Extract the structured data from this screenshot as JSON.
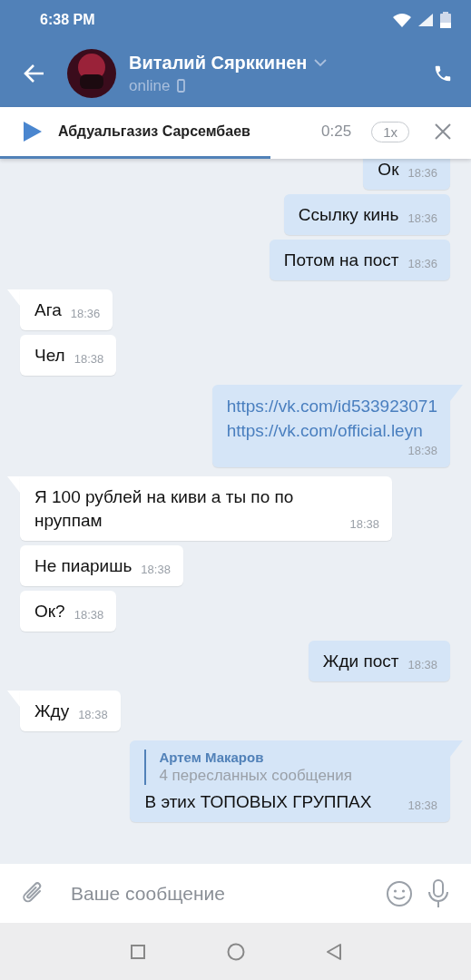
{
  "status_bar": {
    "time": "6:38 PM"
  },
  "header": {
    "name": "Виталий Сярккинен",
    "status": "online"
  },
  "audio_player": {
    "title": "Абдуальгазиз Сарсембаев",
    "duration": "0:25",
    "speed": "1x",
    "level": 0.575
  },
  "messages": [
    {
      "kind": "text",
      "outgoing": true,
      "tail": false,
      "text": "Ок",
      "time": "18:36"
    },
    {
      "kind": "text",
      "outgoing": true,
      "tail": false,
      "text": "Ссылку кинь",
      "time": "18:36"
    },
    {
      "kind": "text",
      "outgoing": true,
      "tail": false,
      "text": "Потом на пост",
      "time": "18:36"
    },
    {
      "kind": "text",
      "outgoing": false,
      "tail": true,
      "text": "Ага",
      "time": "18:36"
    },
    {
      "kind": "text",
      "outgoing": false,
      "tail": false,
      "text": "Чел",
      "time": "18:38"
    },
    {
      "kind": "links",
      "outgoing": true,
      "tail": true,
      "links": [
        "https://vk.com/id533923071",
        "https://vk.com/official.leyn"
      ],
      "time": "18:38"
    },
    {
      "kind": "text",
      "outgoing": false,
      "tail": true,
      "text": "Я 100 рублей на киви а ты по по нруппам",
      "time": "18:38"
    },
    {
      "kind": "text",
      "outgoing": false,
      "tail": false,
      "text": "Не пиаришь",
      "time": "18:38"
    },
    {
      "kind": "text",
      "outgoing": false,
      "tail": false,
      "text": "Ок?",
      "time": "18:38"
    },
    {
      "kind": "text",
      "outgoing": true,
      "tail": false,
      "text": "Жди пост",
      "time": "18:38"
    },
    {
      "kind": "text",
      "outgoing": false,
      "tail": true,
      "text": "Жду",
      "time": "18:38"
    },
    {
      "kind": "forward",
      "outgoing": true,
      "tail": true,
      "author": "Артем Макаров",
      "summary": "4 пересланных сообщения",
      "text": "В этих ТОПОВЫХ ГРУППАХ",
      "time": "18:38"
    }
  ],
  "composer": {
    "placeholder": "Ваше сообщение"
  }
}
